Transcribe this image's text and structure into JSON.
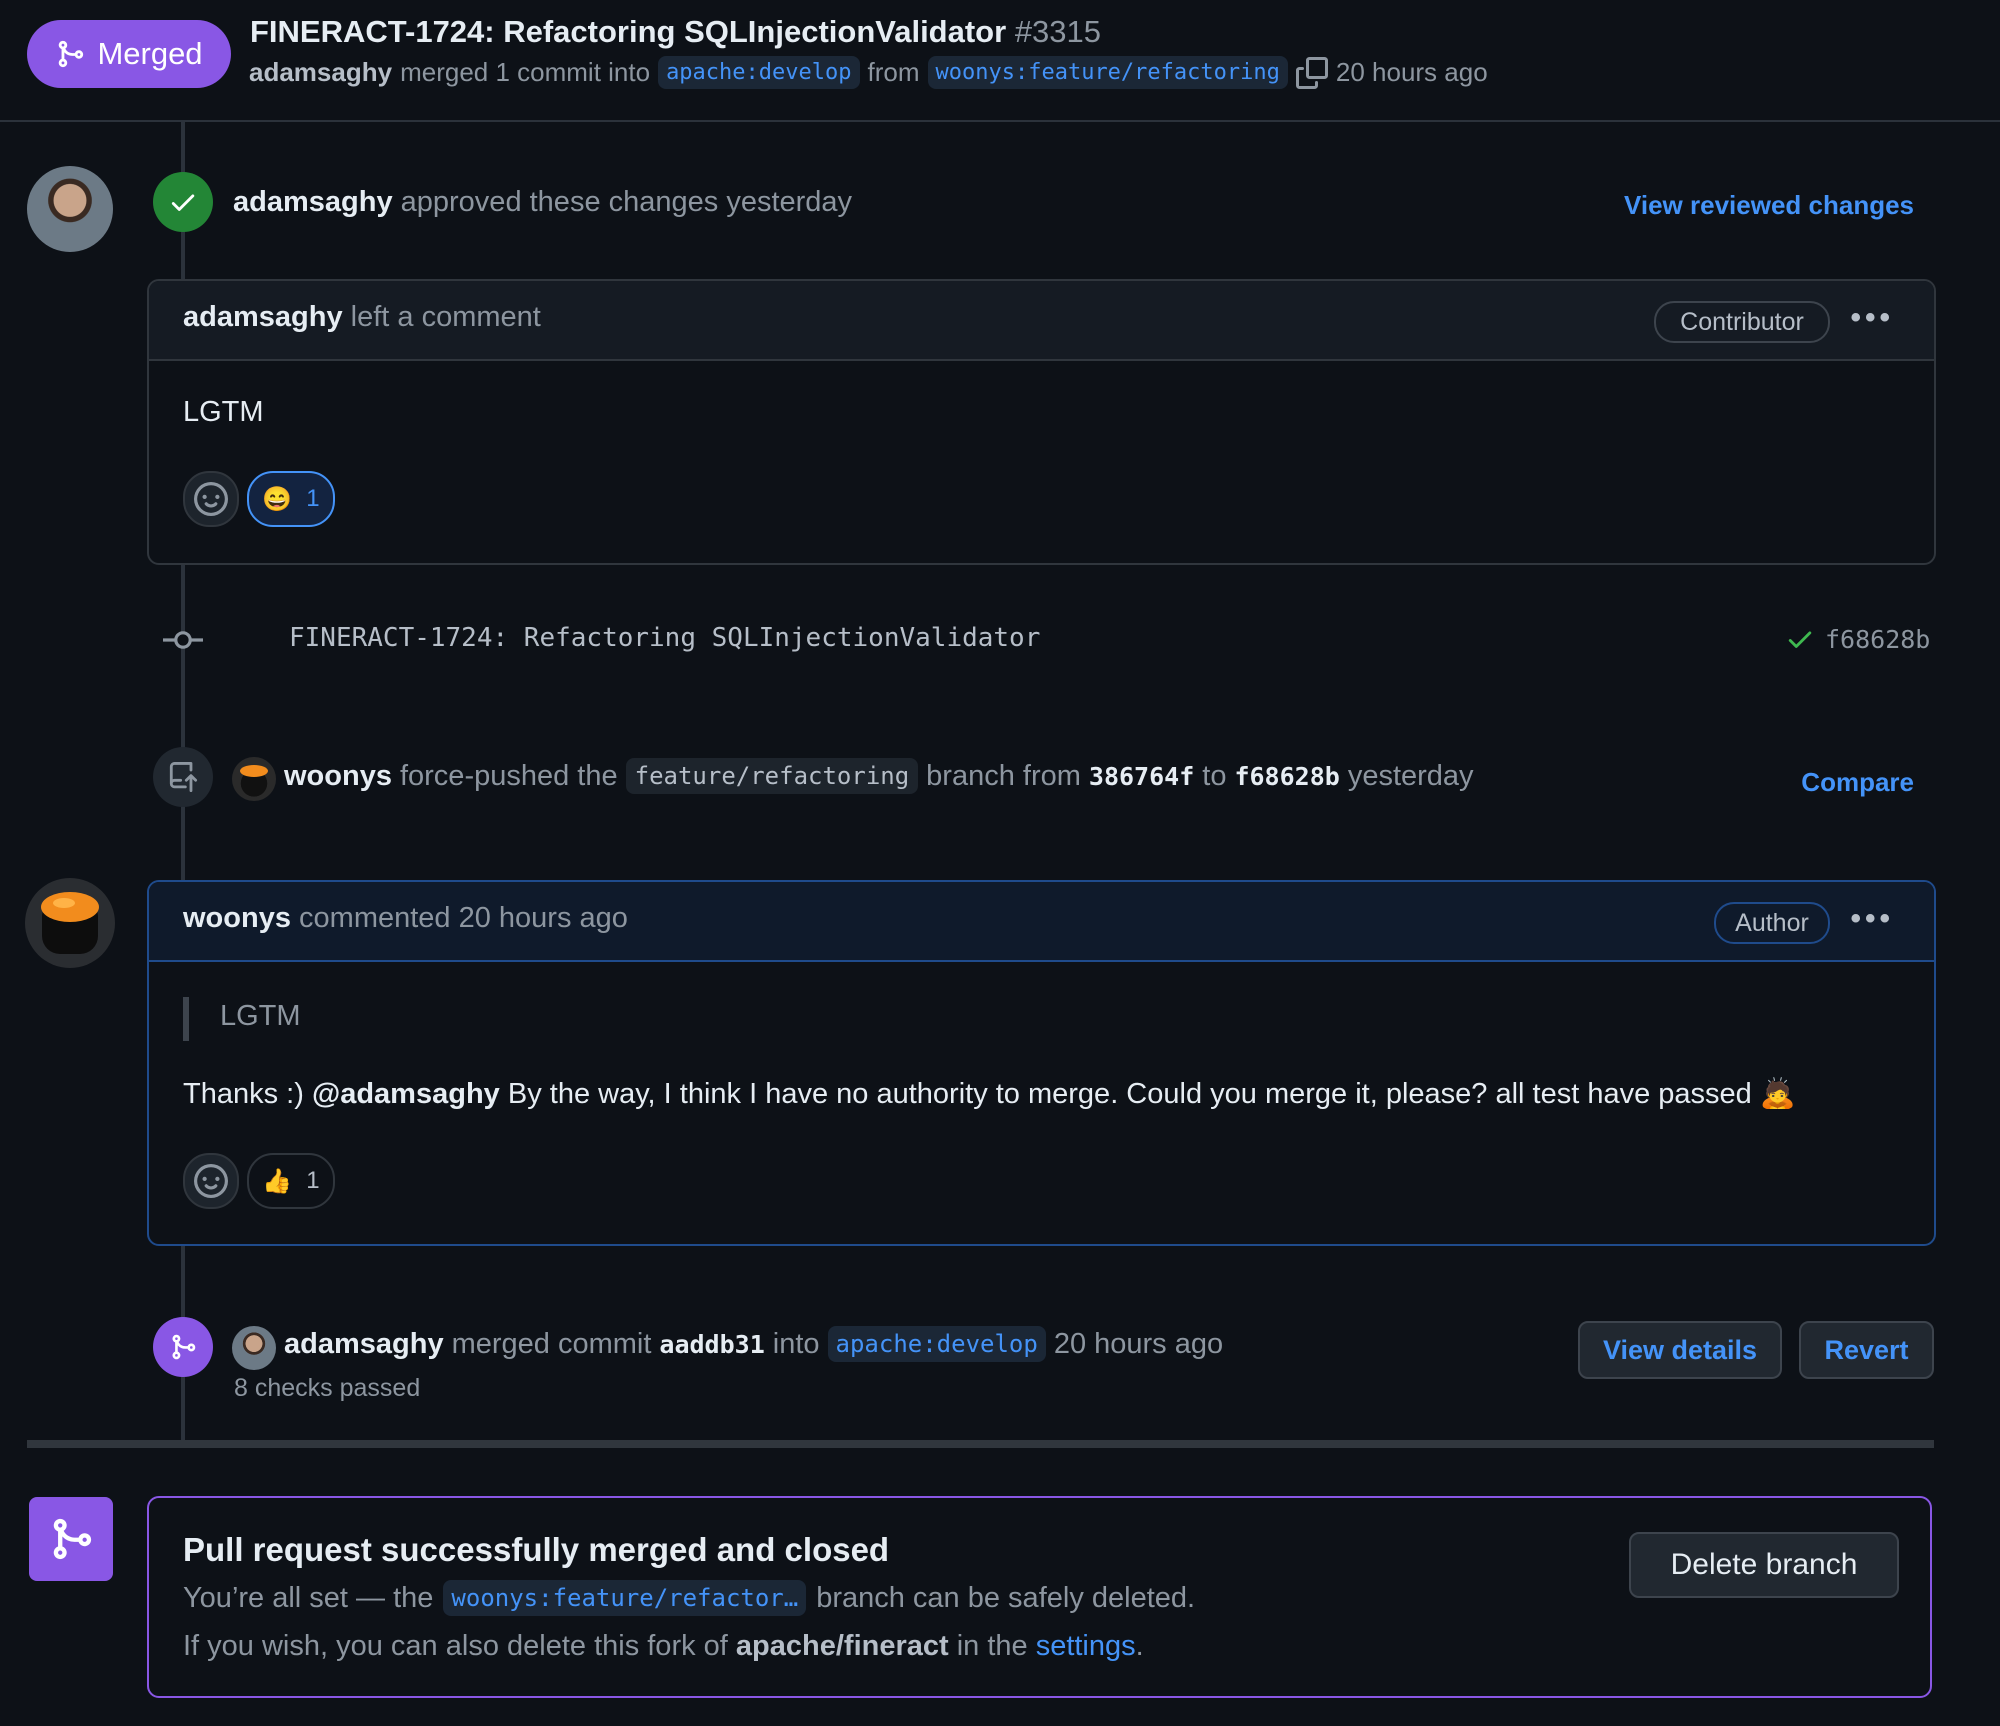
{
  "header": {
    "status_label": "Merged",
    "title": "FINERACT-1724: Refactoring SQLInjectionValidator",
    "number": "#3315",
    "author": "adamsaghy",
    "merge_text": "merged 1 commit into",
    "base_branch": "apache:develop",
    "from_text": "from",
    "head_branch": "woonys:feature/refactoring",
    "time": "20 hours ago"
  },
  "review": {
    "user": "adamsaghy",
    "action": "approved these changes yesterday",
    "view_link": "View reviewed changes"
  },
  "comment1": {
    "user": "adamsaghy",
    "action": "left a comment",
    "role": "Contributor",
    "menu": "•••",
    "body": "LGTM",
    "reaction_emoji": "😄",
    "reaction_count": "1"
  },
  "commit": {
    "message": "FINERACT-1724: Refactoring SQLInjectionValidator",
    "sha": "f68628b"
  },
  "forcepush": {
    "user": "woonys",
    "text1": "force-pushed the",
    "branch": "feature/refactoring",
    "text2": "branch from",
    "from_sha": "386764f",
    "text3": "to",
    "to_sha": "f68628b",
    "time": "yesterday",
    "compare_link": "Compare"
  },
  "comment2": {
    "user": "woonys",
    "action": "commented 20 hours ago",
    "role": "Author",
    "menu": "•••",
    "quote": "LGTM",
    "body_prefix": "Thanks :)",
    "mention": "@adamsaghy",
    "body_rest": "By the way, I think I have no authority to merge. Could you merge it, please? all test have passed",
    "body_emoji": "🙇",
    "reaction_emoji": "👍",
    "reaction_count": "1"
  },
  "merge_event": {
    "user": "adamsaghy",
    "text1": "merged commit",
    "sha": "aaddb31",
    "text2": "into",
    "branch": "apache:develop",
    "time": "20 hours ago",
    "checks": "8 checks passed",
    "view_details": "View details",
    "revert": "Revert"
  },
  "merged_box": {
    "title": "Pull request successfully merged and closed",
    "line1_prefix": "You’re all set — the",
    "branch": "woonys:feature/refactor…",
    "line1_suffix": "branch can be safely deleted.",
    "line2_prefix": "If you wish, you can also delete this fork of",
    "repo": "apache/fineract",
    "line2_mid": "in the",
    "settings_link": "settings",
    "line2_end": ".",
    "delete_button": "Delete branch"
  },
  "colors": {
    "merged_purple": "#8957e5",
    "approve_green": "#238636",
    "link_blue": "#4493f8"
  }
}
